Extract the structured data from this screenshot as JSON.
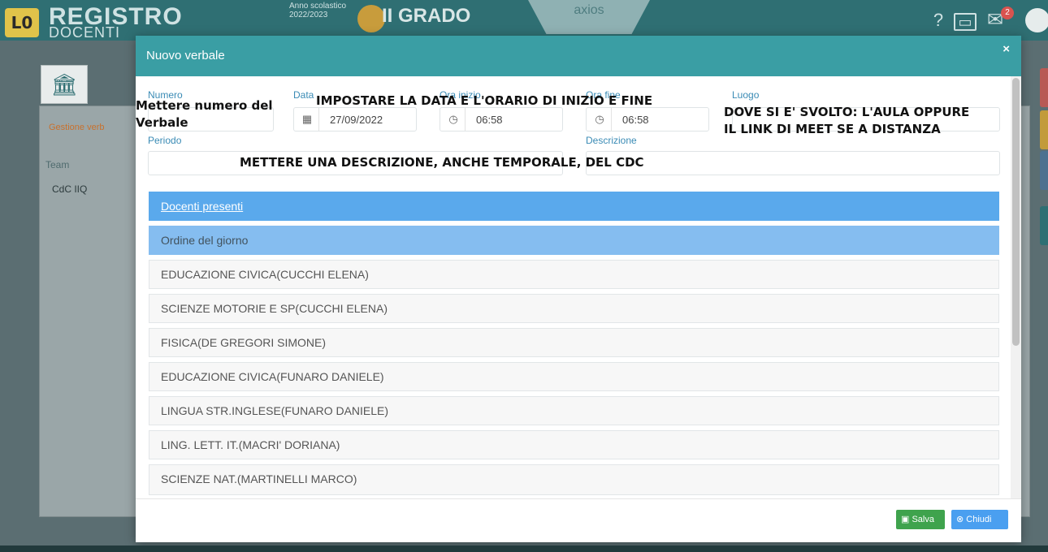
{
  "appbar": {
    "brand_top": "REGISTRO",
    "brand_bottom": "DOCENTI",
    "logo_text": "L0",
    "year_label": "Anno scolastico 2022/2023",
    "grade": "II GRADO",
    "product": "axios",
    "notification_count": "2"
  },
  "background": {
    "tab_label": "Gestione verb",
    "team_label": "Team",
    "team_value": "CdC IIQ"
  },
  "modal": {
    "title": "Nuovo verbale",
    "close_label": "×",
    "fields": {
      "numero_label": "Numero",
      "data_label": "Data",
      "data_value": "27/09/2022",
      "ora_inizio_label": "Ora inizio",
      "ora_inizio_value": "06:58",
      "ora_fine_label": "Ora fine",
      "ora_fine_value": "06:58",
      "luogo_label": "Luogo",
      "periodo_label": "Periodo",
      "descrizione_label": "Descrizione"
    },
    "annotations": {
      "numero": "Mettere numero del Verbale",
      "orario": "IMPOSTARE LA DATA E L'ORARIO DI INIZIO E FINE",
      "luogo": "DOVE SI E' SVOLTO: L'AULA OPPURE IL LINK DI MEET SE A DISTANZA",
      "descrizione": "METTERE UNA DESCRIZIONE, ANCHE TEMPORALE, DEL CDC"
    },
    "sections": {
      "docenti_presenti": "Docenti presenti",
      "ordine_del_giorno": "Ordine del giorno"
    },
    "items": [
      "EDUCAZIONE CIVICA(CUCCHI ELENA)",
      "SCIENZE MOTORIE E SP(CUCCHI ELENA)",
      "FISICA(DE GREGORI SIMONE)",
      "EDUCAZIONE CIVICA(FUNARO DANIELE)",
      "LINGUA STR.INGLESE(FUNARO DANIELE)",
      "LING. LETT. IT.(MACRI' DORIANA)",
      "SCIENZE NAT.(MARTINELLI MARCO)"
    ],
    "buttons": {
      "salva": "Salva",
      "chiudi": "Chiudi"
    }
  },
  "icons": {
    "calendar": "calendar-icon",
    "clock": "clock-icon",
    "help": "help-icon",
    "mail": "mail-icon"
  }
}
